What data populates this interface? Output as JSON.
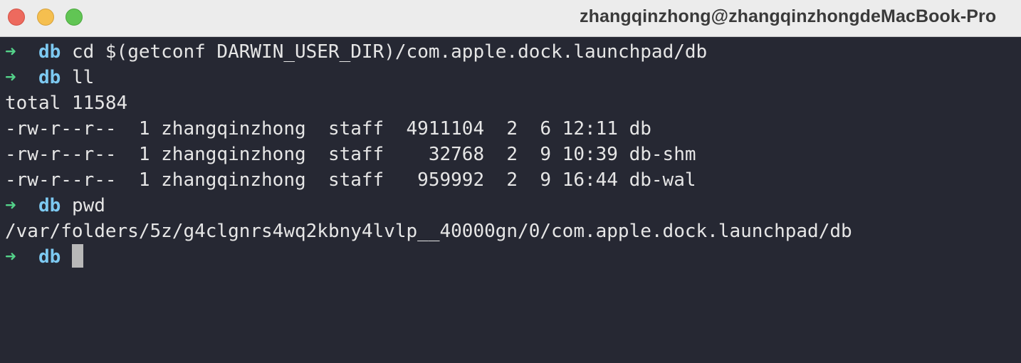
{
  "window": {
    "title": "zhangqinzhong@zhangqinzhongdeMacBook-Pro"
  },
  "prompt": {
    "arrow": "➜",
    "dir": "db"
  },
  "terminal": {
    "lines": [
      {
        "type": "command",
        "text": "cd $(getconf DARWIN_USER_DIR)/com.apple.dock.launchpad/db"
      },
      {
        "type": "command",
        "text": "ll"
      },
      {
        "type": "output",
        "text": "total 11584"
      },
      {
        "type": "output",
        "text": "-rw-r--r--  1 zhangqinzhong  staff  4911104  2  6 12:11 db"
      },
      {
        "type": "output",
        "text": "-rw-r--r--  1 zhangqinzhong  staff    32768  2  9 10:39 db-shm"
      },
      {
        "type": "output",
        "text": "-rw-r--r--  1 zhangqinzhong  staff   959992  2  9 16:44 db-wal"
      },
      {
        "type": "command",
        "text": "pwd"
      },
      {
        "type": "output",
        "text": "/var/folders/5z/g4clgnrs4wq2kbny4lvlp__40000gn/0/com.apple.dock.launchpad/db"
      },
      {
        "type": "prompt",
        "text": ""
      }
    ]
  },
  "colors": {
    "background": "#262833",
    "arrow": "#54d38a",
    "dir": "#7dc9f1",
    "text": "#e6e6e6",
    "cursor": "#b8b8b8"
  }
}
